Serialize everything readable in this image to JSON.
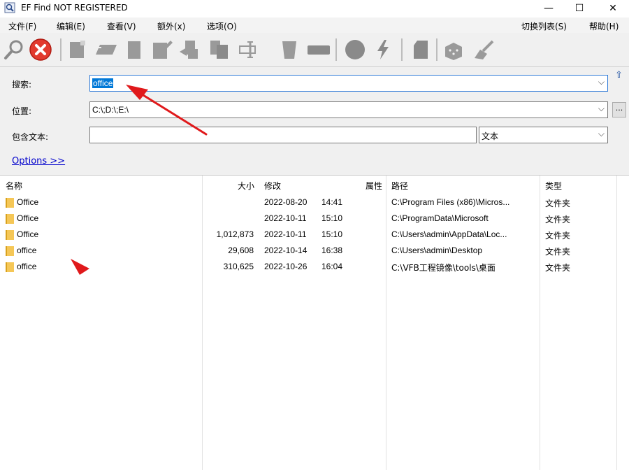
{
  "window": {
    "title": "EF Find NOT REGISTERED",
    "minimize": "—",
    "maximize": "☐",
    "close": "✕"
  },
  "menu": {
    "file": "文件(F)",
    "edit": "编辑(E)",
    "view": "查看(V)",
    "extra": "额外(x)",
    "options": "选项(O)",
    "toggle_list": "切换列表(S)",
    "help": "帮助(H)"
  },
  "search": {
    "search_label": "搜索:",
    "search_value": "office",
    "location_label": "位置:",
    "location_value": "C:\\;D:\\;E:\\",
    "contains_label": "包含文本:",
    "contains_value": "",
    "text_mode": "文本",
    "options_link": "Options  >>",
    "browse": "..."
  },
  "columns": {
    "name": "名称",
    "size": "大小",
    "modified": "修改",
    "attr": "属性",
    "path": "路径",
    "type": "类型"
  },
  "rows": [
    {
      "name": "Office",
      "size": "",
      "date": "2022-08-20",
      "time": "14:41",
      "attr": "",
      "path": "C:\\Program Files (x86)\\Micros...",
      "type": "文件夹"
    },
    {
      "name": "Office",
      "size": "",
      "date": "2022-10-11",
      "time": "15:10",
      "attr": "",
      "path": "C:\\ProgramData\\Microsoft",
      "type": "文件夹"
    },
    {
      "name": "Office",
      "size": "1,012,873",
      "date": "2022-10-11",
      "time": "15:10",
      "attr": "",
      "path": "C:\\Users\\admin\\AppData\\Loc...",
      "type": "文件夹"
    },
    {
      "name": "office",
      "size": "29,608",
      "date": "2022-10-14",
      "time": "16:38",
      "attr": "",
      "path": "C:\\Users\\admin\\Desktop",
      "type": "文件夹"
    },
    {
      "name": "office",
      "size": "310,625",
      "date": "2022-10-26",
      "time": "16:04",
      "attr": "",
      "path": "C:\\VFB工程镜像\\tools\\桌面",
      "type": "文件夹"
    }
  ],
  "colors": {
    "accent": "#0078d7",
    "annotation": "#e0191b",
    "folder": "#f5c757"
  }
}
